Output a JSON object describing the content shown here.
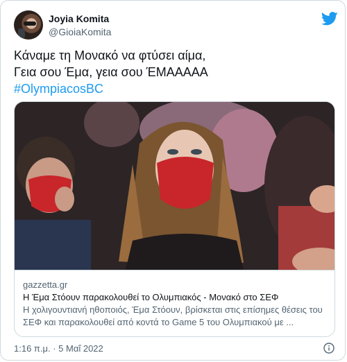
{
  "author": {
    "display_name": "Joyia Komita",
    "handle": "@GioiaKomita"
  },
  "tweet": {
    "lines": [
      "Κάναμε τη Μονακό να φτύσει αίμα,",
      "Γεια σου Έμα, γεια σου ΈΜΑΑΑΑΑ"
    ],
    "hashtag": "#OlympiacosBC"
  },
  "card": {
    "domain": "gazzetta.gr",
    "title": "Η Έμα Στόουν παρακολουθεί το Ολυμπιακός - Μονακό στο ΣΕΦ",
    "description": "Η χολιγουντιανή ηθοποιός, Έμα Στόουν, βρίσκεται στις επίσημες θέσεις του ΣΕΦ και παρακολουθεί από κοντά το Game 5 του Ολυμπιακού με ..."
  },
  "meta": {
    "timestamp": "1:16 π.μ. · 5 Μαΐ 2022"
  },
  "icons": {
    "brand": "twitter-bird-icon",
    "info": "info-icon"
  },
  "colors": {
    "accent": "#1d9bf0",
    "secondary_text": "#536471",
    "border": "#cfd9de",
    "mask_red": "#c8262b"
  }
}
